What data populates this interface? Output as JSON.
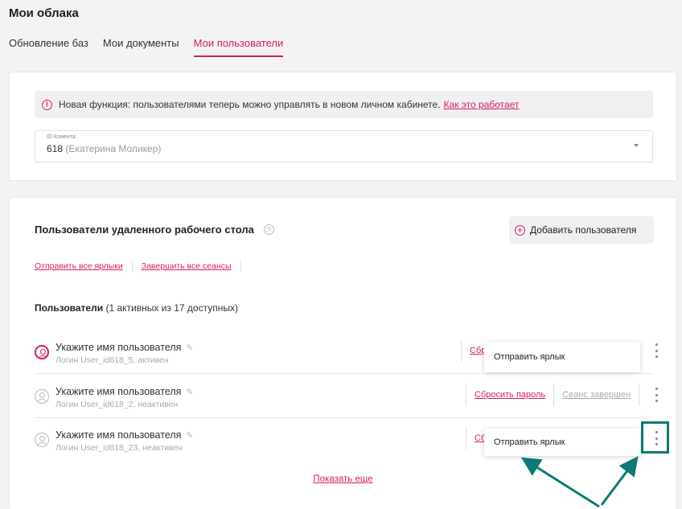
{
  "page": {
    "title": "Мои облака"
  },
  "tabs": [
    {
      "label": "Обновление баз"
    },
    {
      "label": "Мои документы"
    },
    {
      "label": "Мои пользователи"
    }
  ],
  "notice": {
    "text": "Новая функция: пользователями теперь можно управлять в новом личном кабинете.",
    "link": "Как это работает"
  },
  "client_select": {
    "label": "ID Клиента",
    "value": "618",
    "value_note": "(Екатерина Моликер)"
  },
  "section": {
    "title": "Пользователи удаленного рабочего стола",
    "help": "?",
    "add_button": "Добавить пользователя",
    "link_send_all": "Отправить все ярлыки",
    "link_end_all": "Завершить все сеансы",
    "users_label": "Пользователи",
    "users_count": "(1 активных из 17 доступных)"
  },
  "users": [
    {
      "name": "Укажите имя пользователя",
      "login": "Логин User_id618_5, активен",
      "action_reset": "Сбр",
      "popup": "Отправить ярлык"
    },
    {
      "name": "Укажите имя пользователя",
      "login": "Логин User_id618_2, неактивен",
      "action_reset": "Сбросить пароль",
      "action_session": "Сеанс завершен"
    },
    {
      "name": "Укажите имя пользователя",
      "login": "Логин User_id618_23, неактивен",
      "action_reset": "Сб",
      "popup": "Отправить ярлык"
    }
  ],
  "show_more": "Показать еще",
  "colors": {
    "accent": "#d81b60",
    "annotation": "#0d7a74"
  }
}
